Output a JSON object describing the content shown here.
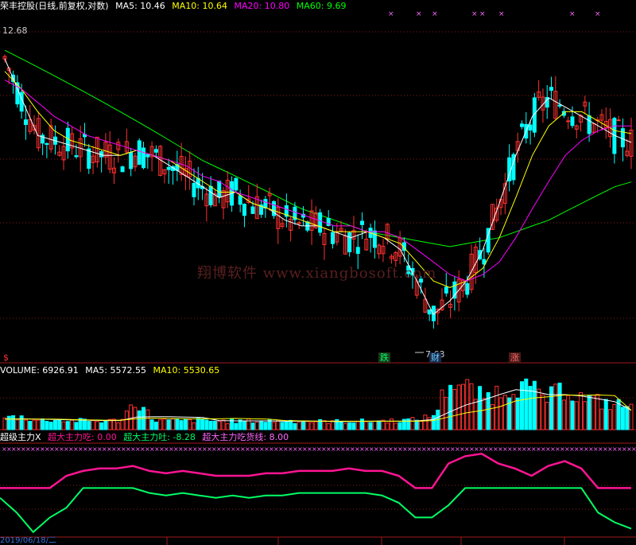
{
  "header": {
    "stock": "荣丰控股(日线,前复权,对数)",
    "ma5": "MA5: 10.46",
    "ma10": "MA10: 10.64",
    "ma20": "MA20: 10.80",
    "ma60": "MA60: 9.69"
  },
  "volume_header": {
    "volume": "VOLUME: 6926.91",
    "ma5": "MA5: 5572.55",
    "ma10": "MA10: 5530.65"
  },
  "indicator_header": {
    "name": "超级主力X",
    "eat": "超大主力吃: 0.00",
    "spit": "超大主力吐: -8.28",
    "line": "超大主力吃货线: 8.00"
  },
  "watermark": "翔博软件 www.xiangbosoft.com",
  "markers": {
    "high_label": "12.68",
    "low_label": "7.63",
    "dollar": "$",
    "die": "跌",
    "cai": "财",
    "zhang": "涨"
  },
  "axis": {
    "first_date": "2019/06/18/二"
  },
  "colors": {
    "up": "#ff3030",
    "down": "#00ffff",
    "ma5": "#ffffff",
    "ma10": "#ffff00",
    "ma20": "#ff00ff",
    "ma60": "#00ff00",
    "grid": "#8b1a1a",
    "eat_line": "#ff1493",
    "spit_line": "#00ff66"
  },
  "chart_data": [
    {
      "type": "line",
      "title": "荣丰控股(日线,前复权,对数)",
      "series": [
        {
          "name": "MA5",
          "values": [
            12.3,
            11.4,
            10.6,
            10.5,
            10.4,
            10.3,
            10.2,
            10.2,
            10.3,
            10.2,
            10.0,
            9.8,
            9.6,
            9.4,
            9.5,
            9.3,
            9.2,
            9.0,
            8.9,
            8.9,
            8.8,
            8.7,
            8.8,
            8.7,
            8.5,
            8.0,
            7.5,
            7.7,
            8.0,
            8.5,
            9.3,
            10.2,
            11.0,
            11.4,
            11.2,
            11.0,
            10.8,
            10.6,
            10.46
          ]
        },
        {
          "name": "MA10",
          "values": [
            12.0,
            11.6,
            11.1,
            10.7,
            10.5,
            10.4,
            10.3,
            10.2,
            10.3,
            10.2,
            10.1,
            9.9,
            9.7,
            9.5,
            9.5,
            9.3,
            9.2,
            9.1,
            9.0,
            8.9,
            8.8,
            8.8,
            8.8,
            8.7,
            8.6,
            8.3,
            8.0,
            7.9,
            8.0,
            8.2,
            8.7,
            9.4,
            10.2,
            10.8,
            11.1,
            11.1,
            10.9,
            10.7,
            10.64
          ]
        },
        {
          "name": "MA20",
          "values": [
            11.8,
            11.6,
            11.3,
            11.0,
            10.8,
            10.6,
            10.5,
            10.4,
            10.3,
            10.2,
            10.1,
            10.0,
            9.8,
            9.7,
            9.5,
            9.4,
            9.3,
            9.2,
            9.1,
            9.0,
            8.9,
            8.9,
            8.8,
            8.8,
            8.7,
            8.5,
            8.3,
            8.1,
            8.0,
            8.1,
            8.3,
            8.7,
            9.2,
            9.7,
            10.2,
            10.5,
            10.7,
            10.8,
            10.8
          ]
        },
        {
          "name": "MA60",
          "values": [
            12.5,
            12.3,
            12.1,
            11.9,
            11.7,
            11.5,
            11.3,
            11.1,
            10.9,
            10.7,
            10.5,
            10.3,
            10.1,
            9.95,
            9.8,
            9.65,
            9.5,
            9.35,
            9.2,
            9.1,
            9.0,
            8.9,
            8.8,
            8.75,
            8.7,
            8.65,
            8.6,
            8.55,
            8.6,
            8.65,
            8.7,
            8.8,
            8.9,
            9.0,
            9.15,
            9.3,
            9.45,
            9.6,
            9.69
          ]
        }
      ]
    },
    {
      "type": "bar",
      "title": "VOLUME",
      "series": [
        {
          "name": "VOLUME",
          "values": [
            3400,
            3600,
            2600,
            2800,
            2500,
            2500,
            2400,
            2600,
            8400,
            2800,
            2500,
            2500,
            2600,
            2400,
            2300,
            2500,
            2400,
            2500,
            2400,
            2300,
            2300,
            2300,
            2400,
            2500,
            2600,
            2800,
            4000,
            14000,
            12000,
            9000,
            11000,
            13000,
            11000,
            9000,
            12000,
            9000,
            8000,
            7000,
            6926.91
          ]
        },
        {
          "name": "MA5",
          "values": [
            3000,
            3100,
            3000,
            2900,
            2800,
            2700,
            2600,
            2600,
            3600,
            3700,
            3700,
            3600,
            3500,
            2600,
            2500,
            2500,
            2500,
            2400,
            2400,
            2400,
            2300,
            2300,
            2400,
            2400,
            2400,
            2500,
            2900,
            5100,
            7100,
            8400,
            10000,
            11400,
            11000,
            10000,
            10000,
            9600,
            8800,
            8000,
            5572.55
          ]
        },
        {
          "name": "MA10",
          "values": [
            3000,
            3000,
            3000,
            3000,
            2900,
            2800,
            2700,
            2700,
            3100,
            3300,
            3200,
            3100,
            3100,
            3100,
            3200,
            3100,
            3000,
            2600,
            2500,
            2400,
            2400,
            2400,
            2400,
            2400,
            2400,
            2400,
            2600,
            3700,
            4800,
            5500,
            6500,
            8200,
            9000,
            9400,
            9900,
            9800,
            9900,
            9700,
            5530.65
          ]
        }
      ]
    },
    {
      "type": "line",
      "title": "超级主力X",
      "series": [
        {
          "name": "超大主力吃",
          "values": [
            0,
            0,
            0,
            0,
            2.5,
            3.5,
            4,
            4,
            4.5,
            3.5,
            3,
            3.5,
            3,
            2.5,
            2.5,
            2.5,
            3,
            3,
            3.5,
            3.5,
            3.5,
            4,
            3.5,
            3.5,
            2.5,
            0,
            0,
            5,
            6.5,
            7,
            5,
            4,
            2.5,
            4.5,
            5.5,
            4,
            0,
            0,
            0
          ]
        },
        {
          "name": "超大主力吐",
          "values": [
            -2,
            -5,
            -9,
            -6,
            -4,
            0,
            0,
            0,
            0,
            -1,
            -1.5,
            -1,
            -1.5,
            -2,
            -1.5,
            -2,
            -1.5,
            -1.5,
            -1,
            -1,
            -1,
            -1,
            -1,
            -1.5,
            -3,
            -6,
            -6,
            -3.5,
            0,
            0,
            0,
            0,
            0,
            0,
            0,
            0,
            -5,
            -7,
            -8.28
          ]
        },
        {
          "name": "超大主力吃货线",
          "values": [
            8,
            8,
            8,
            8,
            8,
            8,
            8,
            8,
            8,
            8,
            8,
            8,
            8,
            8,
            8,
            8,
            8,
            8,
            8,
            8,
            8,
            8,
            8,
            8,
            8,
            8,
            8,
            8,
            8,
            8,
            8,
            8,
            8,
            8,
            8,
            8,
            8,
            8,
            8
          ]
        }
      ]
    }
  ]
}
